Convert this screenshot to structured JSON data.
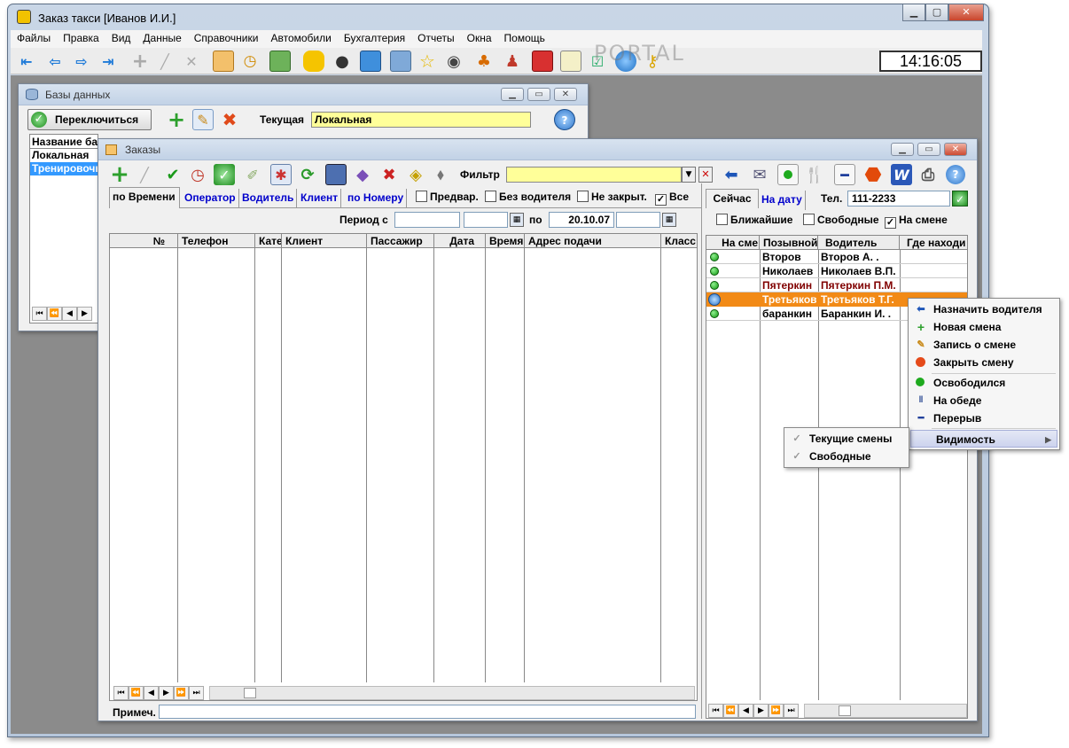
{
  "app": {
    "title": "Заказ такси  [Иванов И.И.]",
    "clock": "14:16:05"
  },
  "menu": [
    "Файлы",
    "Правка",
    "Вид",
    "Данные",
    "Справочники",
    "Автомобили",
    "Бухгалтерия",
    "Отчеты",
    "Окна",
    "Помощь"
  ],
  "db_window": {
    "title": "Базы данных",
    "switch_label": "Переключиться",
    "current_label": "Текущая",
    "current_value": "Локальная",
    "list_header": "Название ба",
    "items": [
      "Локальная",
      "Тренировочн"
    ]
  },
  "orders": {
    "title": "Заказы",
    "filter_label": "Фильтр",
    "filter_value": "",
    "tabs": [
      "по Времени",
      "Оператор",
      "Водитель",
      "Клиент",
      "по Номеру"
    ],
    "checks": [
      {
        "label": "Предвар.",
        "checked": false
      },
      {
        "label": "Без водителя",
        "checked": false
      },
      {
        "label": "Не закрыт.",
        "checked": false
      },
      {
        "label": "Все",
        "checked": true
      }
    ],
    "period_label": "Период с",
    "period_from": "",
    "period_to_label": "по",
    "period_to": "20.10.07",
    "columns": [
      "№",
      "Телефон",
      "Кате",
      "Клиент",
      "Пассажир",
      "Дата",
      "Время",
      "Адрес подачи",
      "Класс"
    ],
    "note_label": "Примеч."
  },
  "drivers": {
    "tabs": [
      "Сейчас",
      "На дату"
    ],
    "tel_label": "Тел.",
    "tel_value": "111-2233",
    "checks": [
      {
        "label": "Ближайшие",
        "checked": false
      },
      {
        "label": "Свободные",
        "checked": false
      },
      {
        "label": "На смене",
        "checked": true
      }
    ],
    "columns": [
      "На сме",
      "Позывной",
      "Водитель",
      "Где находи"
    ],
    "rows": [
      {
        "callsign": "Второв",
        "driver": "Второв А. .",
        "status": "green"
      },
      {
        "callsign": "Николаев",
        "driver": "Николаев В.П.",
        "status": "green"
      },
      {
        "callsign": "Пятеркин",
        "driver": "Пятеркин П.М.",
        "status": "green",
        "color": "#800000"
      },
      {
        "callsign": "Третьяков",
        "driver": "Третьяков Т.Г.",
        "status": "selected"
      },
      {
        "callsign": "баранкин",
        "driver": "Баранкин И. .",
        "status": "green"
      }
    ]
  },
  "context_menu": {
    "items": [
      "Назначить водителя",
      "Новая смена",
      "Запись о смене",
      "Закрыть смену",
      "Освободился",
      "На обеде",
      "Перерыв",
      "Видимость"
    ]
  },
  "submenu": {
    "items": [
      "Текущие смены",
      "Свободные"
    ]
  },
  "watermark": "PORTAL"
}
